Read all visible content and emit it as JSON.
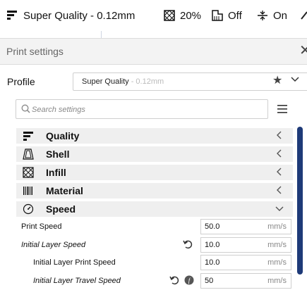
{
  "topbar": {
    "profile": "Super Quality - 0.12mm",
    "infill": "20%",
    "support": "Off",
    "adhesion": "On"
  },
  "panel": {
    "title": "Print settings",
    "close_label": "✕"
  },
  "profile": {
    "label": "Profile",
    "name": "Super Quality",
    "variant": " - 0.12mm"
  },
  "search": {
    "placeholder": "Search settings"
  },
  "categories": [
    {
      "label": "Quality",
      "icon": "quality-icon",
      "expanded": false
    },
    {
      "label": "Shell",
      "icon": "shell-icon",
      "expanded": false
    },
    {
      "label": "Infill",
      "icon": "infill-icon",
      "expanded": false
    },
    {
      "label": "Material",
      "icon": "material-icon",
      "expanded": false
    },
    {
      "label": "Speed",
      "icon": "speed-icon",
      "expanded": true
    }
  ],
  "settings": [
    {
      "label": "Print Speed",
      "value": "50.0",
      "unit": "mm/s",
      "italic": false
    },
    {
      "label": "Initial Layer Speed",
      "value": "10.0",
      "unit": "mm/s",
      "italic": true
    },
    {
      "label": "Initial Layer Print Speed",
      "value": "10.0",
      "unit": "mm/s",
      "italic": false
    },
    {
      "label": "Initial Layer Travel Speed",
      "value": "50",
      "unit": "mm/s",
      "italic": true
    }
  ],
  "colors": {
    "accent": "#1e3a78",
    "category_bg": "#efefef",
    "header_bg": "#f3f3f3"
  }
}
